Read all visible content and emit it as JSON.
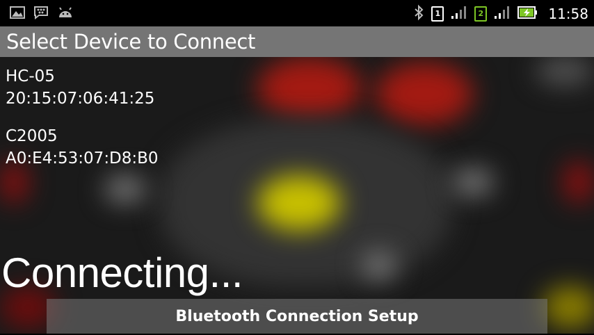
{
  "status_bar": {
    "time": "11:58",
    "sim1": "1",
    "sim2": "2",
    "icons": [
      "gallery-icon",
      "bbm-icon",
      "android-icon",
      "bluetooth-icon",
      "signal-icon",
      "battery-charging-icon"
    ]
  },
  "header": {
    "title": "Select Device to Connect"
  },
  "devices": [
    {
      "name": "HC-05",
      "address": "20:15:07:06:41:25"
    },
    {
      "name": "C2005",
      "address": "A0:E4:53:07:D8:B0"
    }
  ],
  "status_text": "Connecting...",
  "bottom_bar": {
    "label": "Bluetooth Connection Setup"
  },
  "colors": {
    "header_bg": "#757575",
    "accent_green": "#7dc624"
  }
}
